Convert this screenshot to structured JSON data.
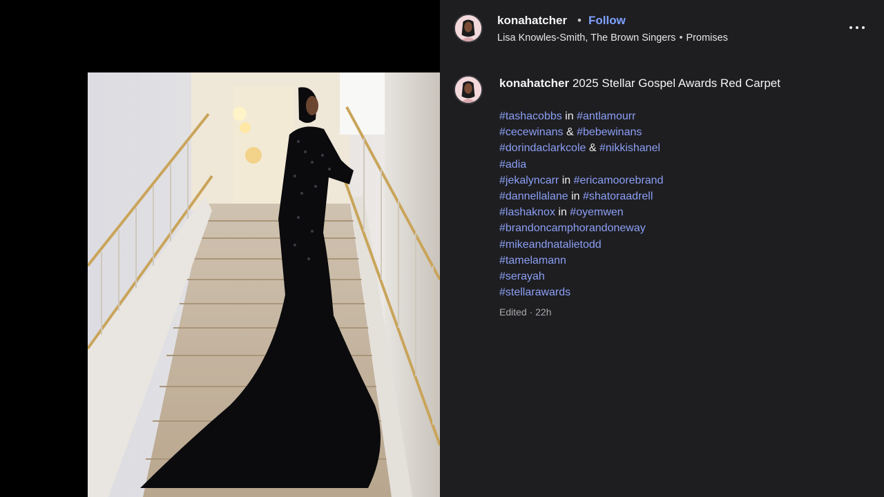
{
  "post": {
    "username": "konahatcher",
    "dot": "•",
    "follow_label": "Follow",
    "audio": {
      "artist": "Lisa Knowles-Smith, The Brown Singers",
      "separator": "•",
      "track": "Promises"
    },
    "more_icon": "more-horizontal-icon"
  },
  "caption": {
    "username": "konahatcher",
    "text": "2025 Stellar Gospel Awards Red Carpet",
    "lines": [
      {
        "a": "#tashacobbs",
        "join": " in ",
        "b": "#antlamourr"
      },
      {
        "a": "#cecewinans",
        "join": " & ",
        "b": "#bebewinans"
      },
      {
        "a": "#dorindaclarkcole",
        "join": " & ",
        "b": "#nikkishanel"
      },
      {
        "a": "#adia",
        "join": "",
        "b": ""
      },
      {
        "a": "#jekalyncarr",
        "join": " in ",
        "b": "#ericamoorebrand"
      },
      {
        "a": "#dannellalane",
        "join": " in ",
        "b": "#shatoraadrell"
      },
      {
        "a": "#lashaknox",
        "join": " in ",
        "b": "#oyemwen"
      },
      {
        "a": "#brandoncamphorandoneway",
        "join": "",
        "b": ""
      },
      {
        "a": "#mikeandnatalietodd",
        "join": "",
        "b": ""
      },
      {
        "a": "#tamelamann",
        "join": "",
        "b": ""
      },
      {
        "a": "#serayah",
        "join": "",
        "b": ""
      },
      {
        "a": "#stellarawards",
        "join": "",
        "b": ""
      }
    ],
    "meta": "Edited · 22h"
  },
  "colors": {
    "panel_bg": "#1e1e21",
    "link_blue": "#7ea1ff",
    "hashtag": "#8c9ff5"
  }
}
